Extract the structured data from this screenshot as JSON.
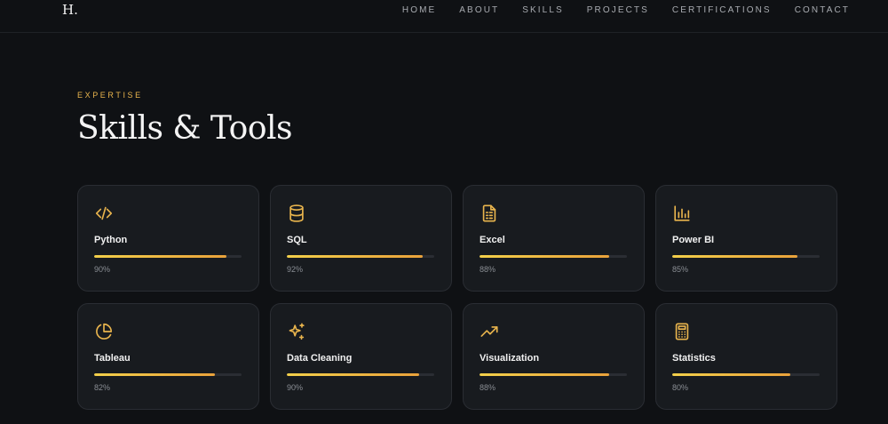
{
  "header": {
    "logo": "H.",
    "nav": [
      "HOME",
      "ABOUT",
      "SKILLS",
      "PROJECTS",
      "CERTIFICATIONS",
      "CONTACT"
    ]
  },
  "section": {
    "eyebrow": "EXPERTISE",
    "title": "Skills & Tools"
  },
  "theme": {
    "accent": "#e8b44d",
    "bar_start": "#f2cf4a",
    "bar_end": "#e9a23b"
  },
  "skills": [
    {
      "name": "Python",
      "percent_label": "90%",
      "level": 90,
      "icon": "code-icon"
    },
    {
      "name": "SQL",
      "percent_label": "92%",
      "level": 92,
      "icon": "database-icon"
    },
    {
      "name": "Excel",
      "percent_label": "88%",
      "level": 88,
      "icon": "spreadsheet-icon"
    },
    {
      "name": "Power BI",
      "percent_label": "85%",
      "level": 85,
      "icon": "bar-chart-icon"
    },
    {
      "name": "Tableau",
      "percent_label": "82%",
      "level": 82,
      "icon": "pie-chart-icon"
    },
    {
      "name": "Data Cleaning",
      "percent_label": "90%",
      "level": 90,
      "icon": "sparkles-icon"
    },
    {
      "name": "Visualization",
      "percent_label": "88%",
      "level": 88,
      "icon": "trending-up-icon"
    },
    {
      "name": "Statistics",
      "percent_label": "80%",
      "level": 80,
      "icon": "calculator-icon"
    }
  ]
}
